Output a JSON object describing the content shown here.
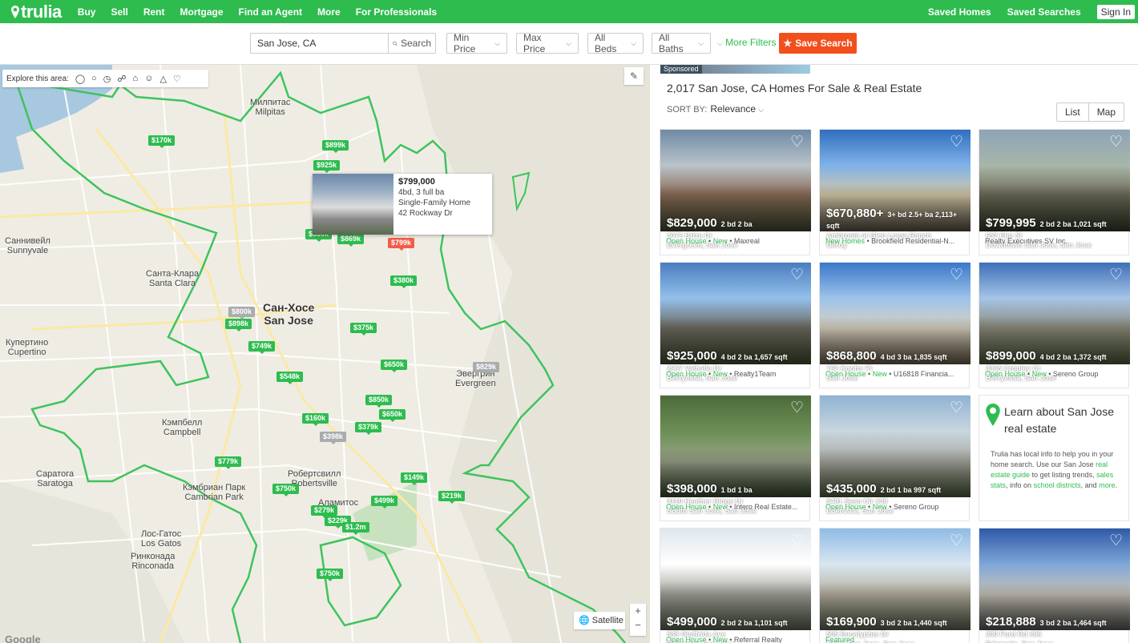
{
  "nav": {
    "logo": "trulia",
    "links": [
      "Buy",
      "Sell",
      "Rent",
      "Mortgage",
      "Find an Agent",
      "More",
      "For Professionals"
    ],
    "saved_homes": "Saved Homes",
    "saved_searches": "Saved Searches",
    "sign_in": "Sign In"
  },
  "search": {
    "location": "San Jose, CA",
    "search_btn": "Search",
    "min_price": "Min Price",
    "max_price": "Max Price",
    "all_beds": "All Beds",
    "all_baths": "All Baths",
    "more_filters": "More Filters",
    "save_search": "Save Search"
  },
  "map": {
    "explore_label": "Explore this area:",
    "satellite": "Satellite",
    "google": "Google",
    "cities": [
      {
        "ru": "Милпитас",
        "en": "Milpitas"
      },
      {
        "ru": "Саннивейл",
        "en": "Sunnyvale"
      },
      {
        "ru": "Санта-Клара",
        "en": "Santa Clara"
      },
      {
        "ru": "Сан-Хосе",
        "en": "San Jose"
      },
      {
        "ru": "Купертино",
        "en": "Cupertino"
      },
      {
        "ru": "Кэмпбелл",
        "en": "Campbell"
      },
      {
        "ru": "Саратога",
        "en": "Saratoga"
      },
      {
        "ru": "Кэмбриан Парк",
        "en": "Cambrian Park"
      },
      {
        "ru": "Лос-Гатос",
        "en": "Los Gatos"
      },
      {
        "ru": "Ринконада",
        "en": "Rinconada"
      },
      {
        "ru": "Робертсвилл",
        "en": "Robertsville"
      },
      {
        "ru": "Эвергрин",
        "en": "Evergreen"
      },
      {
        "ru": "Аламитос",
        "en": ""
      }
    ],
    "pins": [
      {
        "label": "$170k",
        "kind": "green"
      },
      {
        "label": "$899k",
        "kind": "green"
      },
      {
        "label": "$925k",
        "kind": "green"
      },
      {
        "label": "$550k",
        "kind": "green"
      },
      {
        "label": "$869k",
        "kind": "green"
      },
      {
        "label": "$799k",
        "kind": "red"
      },
      {
        "label": "$380k",
        "kind": "green"
      },
      {
        "label": "$800k",
        "kind": "grey"
      },
      {
        "label": "$898k",
        "kind": "green"
      },
      {
        "label": "$375k",
        "kind": "green"
      },
      {
        "label": "$749k",
        "kind": "green"
      },
      {
        "label": "$650k",
        "kind": "green"
      },
      {
        "label": "$829k",
        "kind": "grey"
      },
      {
        "label": "$548k",
        "kind": "green"
      },
      {
        "label": "$850k",
        "kind": "green"
      },
      {
        "label": "$650k",
        "kind": "green"
      },
      {
        "label": "$160k",
        "kind": "green"
      },
      {
        "label": "$379k",
        "kind": "green"
      },
      {
        "label": "$398k",
        "kind": "grey"
      },
      {
        "label": "$779k",
        "kind": "green"
      },
      {
        "label": "$149k",
        "kind": "green"
      },
      {
        "label": "$750k",
        "kind": "green"
      },
      {
        "label": "$219k",
        "kind": "green"
      },
      {
        "label": "$499k",
        "kind": "green"
      },
      {
        "label": "$279k",
        "kind": "green"
      },
      {
        "label": "$229k",
        "kind": "green"
      },
      {
        "label": "$1.2m",
        "kind": "green"
      },
      {
        "label": "$750k",
        "kind": "green"
      }
    ],
    "popup": {
      "price": "$799,000",
      "beds": "4bd, 3 full ba",
      "type": "Single-Family Home",
      "address": "42 Rockway Dr"
    }
  },
  "listings": {
    "sponsored": "Sponsored",
    "title": "2,017 San Jose, CA Homes For Sale & Real Estate",
    "sort_label": "SORT BY:",
    "sort_value": "Relevance",
    "list": "List",
    "map": "Map",
    "cards": [
      {
        "price": "$829,000",
        "bb": "2 bd 2 ba",
        "addr": "3072 Briza Dr",
        "area": "Evergreen, San Jose",
        "tags": [
          "Open House",
          "New"
        ],
        "agent": "Maxreal"
      },
      {
        "price": "$670,880+",
        "bb": "3+ bd 2.5+ ba 2,113+ sqft",
        "addr": "Ambrosia at Glen Loma Ranch",
        "area": "Gilroy",
        "tags": [
          "New Homes"
        ],
        "agent": "Brookfield Residential-N..."
      },
      {
        "price": "$799,995",
        "bb": "2 bd 2 ba 1,021 sqft",
        "addr": "652 Elm St",
        "area": "Downtown San Jose, San Jose",
        "tags": [],
        "agent": "Realty Executives SV Inc."
      },
      {
        "price": "$925,000",
        "bb": "4 bd 2 ba 1,657 sqft",
        "addr": "2967 Valhalla Dr",
        "area": "Berryessa, San Jose",
        "tags": [
          "Open House",
          "New"
        ],
        "agent": "Realty1Team"
      },
      {
        "price": "$868,800",
        "bb": "4 bd 3 ba 1,835 sqft",
        "addr": "762 Knotts Pl",
        "area": "San Jose",
        "tags": [
          "Open House",
          "New"
        ],
        "agent": "U16818 Financia..."
      },
      {
        "price": "$899,000",
        "bb": "4 bd 2 ba 1,372 sqft",
        "addr": "3365 Cropley Ct",
        "area": "Berryessa, San Jose",
        "tags": [
          "Open House",
          "New"
        ],
        "agent": "Sereno Group"
      },
      {
        "price": "$398,000",
        "bb": "1 bd 1 ba",
        "addr": "3110 Heather Ridge Dr",
        "area": "South San Jose, San Jose",
        "tags": [
          "Open House",
          "New"
        ],
        "agent": "Intero Real Estate..."
      },
      {
        "price": "$435,000",
        "bb": "2 bd 1 ba 997 sqft",
        "addr": "5481 Sean Cir #38",
        "area": "Edenvale, San Jose",
        "tags": [
          "Open House",
          "New"
        ],
        "agent": "Sereno Group"
      },
      {
        "price": "$499,000",
        "bb": "2 bd 2 ba 1,101 sqft",
        "addr": "538 Giuffrida Ave",
        "area": "Edenvale, San Jose",
        "tags": [
          "Open House",
          "New"
        ],
        "agent": "Referral Realty"
      },
      {
        "price": "$169,900",
        "bb": "3 bd 2 ba 1,440 sqft",
        "addr": "505 Eucalyptus Dr",
        "area": "North San Jose, San Jose",
        "tags": [
          "Featured"
        ],
        "agent": ""
      },
      {
        "price": "$218,888",
        "bb": "3 bd 2 ba 1,464 sqft",
        "addr": "200 Ford Rd #96",
        "area": "Edenvale, San Jose",
        "tags": [],
        "agent": ""
      }
    ],
    "learn": {
      "title": "Learn about San Jose real estate",
      "text1": "Trulia has local info to help you in your home search. Use our San Jose",
      "link1": "real estate guide",
      "text2": "to get listing trends,",
      "link2": "sales stats",
      "text3": ", info on",
      "link3": "school districts",
      "text4": ", and",
      "link4": "more",
      "text5": "."
    }
  },
  "colors": {
    "brand": "#2ebc4f",
    "save": "#f34f1d"
  }
}
